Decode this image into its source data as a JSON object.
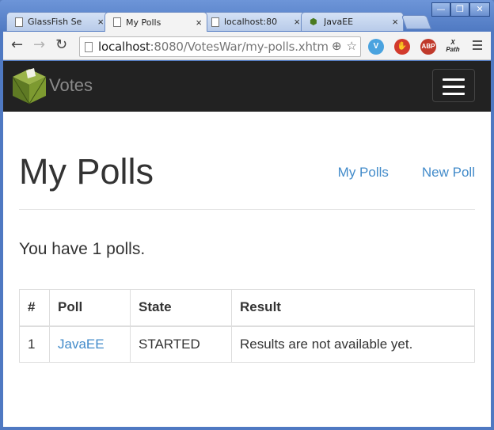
{
  "window": {
    "controls": [
      "—",
      "❐",
      "✕"
    ]
  },
  "tabs": [
    {
      "title": "GlassFish Se",
      "close": "×",
      "icon": "page-icon",
      "active": false
    },
    {
      "title": "My Polls",
      "close": "×",
      "icon": "page-icon",
      "active": true
    },
    {
      "title": "localhost:80",
      "close": "×",
      "icon": "page-icon",
      "active": false
    },
    {
      "title": "JavaEE",
      "close": "×",
      "icon": "votes-favicon",
      "active": false
    }
  ],
  "toolbar": {
    "back": "←",
    "forward": "→",
    "reload": "↻",
    "url_host": "localhost",
    "url_rest": ":8080/VotesWar/my-polls.xhtml",
    "extensions": {
      "v": "V",
      "stop": "✋",
      "abp": "ABP",
      "xpath": "X Path"
    }
  },
  "navbar": {
    "brand": "Votes"
  },
  "page": {
    "title": "My Polls",
    "links": {
      "my_polls": "My Polls",
      "new_poll": "New Poll"
    },
    "summary": "You have 1 polls."
  },
  "table": {
    "headers": [
      "#",
      "Poll",
      "State",
      "Result"
    ],
    "rows": [
      {
        "num": "1",
        "poll": "JavaEE",
        "state": "STARTED",
        "result": "Results are not available yet."
      }
    ]
  },
  "colors": {
    "navbar_bg": "#222222",
    "link": "#428bca",
    "window_frame": "#4f79c2"
  }
}
